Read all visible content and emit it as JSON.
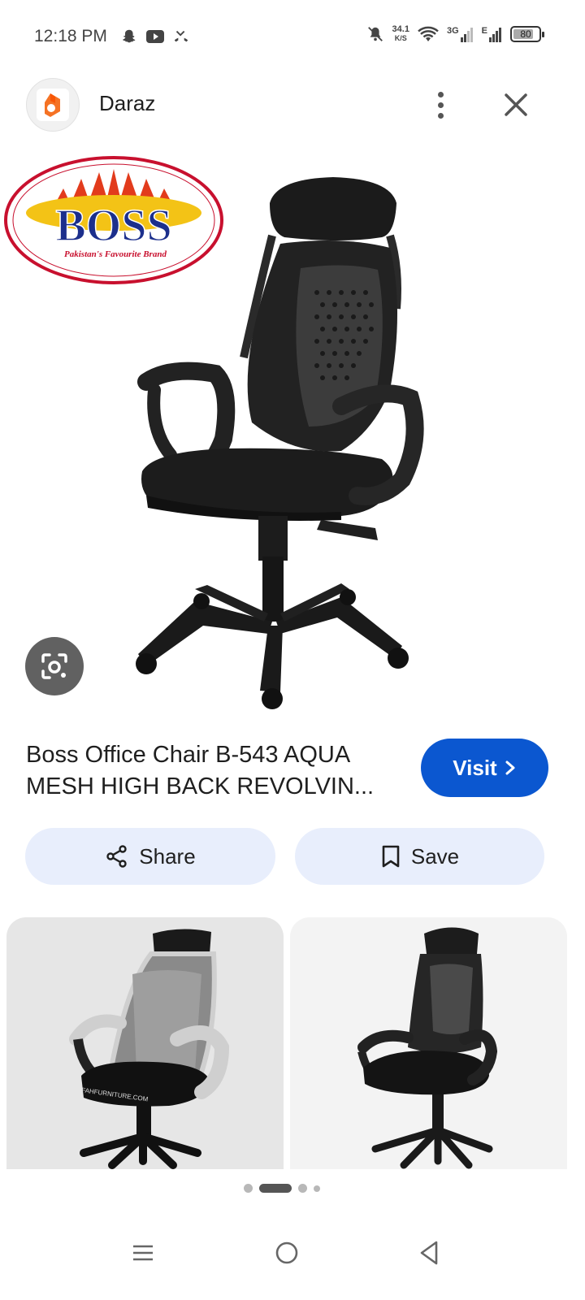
{
  "status_bar": {
    "time": "12:18 PM",
    "left_icons": [
      "snapchat-icon",
      "youtube-icon",
      "missed-call-icon"
    ],
    "network_speed_value": "34.1",
    "network_speed_unit": "K/S",
    "signal_1_label": "3G",
    "signal_2_label": "E",
    "battery_level": "80",
    "right_icons": [
      "bell-off-icon",
      "wifi-icon",
      "signal-icon",
      "battery-icon"
    ]
  },
  "header": {
    "app_name": "Daraz",
    "logo_icon": "daraz-logo-icon",
    "menu_icon": "more-vert-icon",
    "close_icon": "close-icon"
  },
  "main_image": {
    "brand_logo_text": "BOSS",
    "brand_tagline": "Pakistan's Favourite Brand",
    "lens_icon": "google-lens-icon"
  },
  "product": {
    "title": "Boss Office Chair B-543 AQUA MESH HIGH BACK REVOLVIN...",
    "visit_label": "Visit"
  },
  "actions": {
    "share_label": "Share",
    "save_label": "Save"
  },
  "related": {
    "card_1_watermark": "FAHFURNITURE.COM"
  },
  "pager": {
    "total": 4,
    "active_index": 1
  },
  "colors": {
    "accent": "#0b57d0",
    "action_bg": "#e8eefc",
    "lens_bg": "#616161"
  }
}
